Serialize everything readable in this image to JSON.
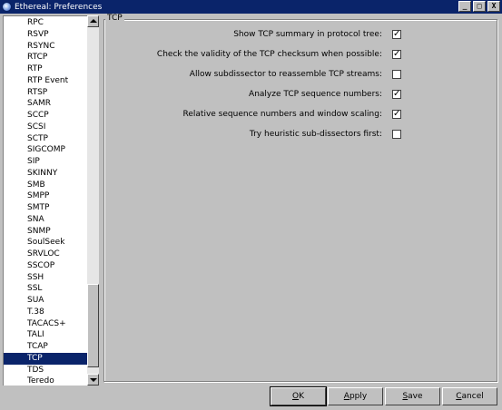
{
  "window": {
    "title": "Ethereal: Preferences",
    "minimize_glyph": "_",
    "maximize_glyph": "□",
    "close_glyph": "X"
  },
  "protocol_list": {
    "items": [
      "RPC",
      "RSVP",
      "RSYNC",
      "RTCP",
      "RTP",
      "RTP Event",
      "RTSP",
      "SAMR",
      "SCCP",
      "SCSI",
      "SCTP",
      "SIGCOMP",
      "SIP",
      "SKINNY",
      "SMB",
      "SMPP",
      "SMTP",
      "SNA",
      "SNMP",
      "SoulSeek",
      "SRVLOC",
      "SSCOP",
      "SSH",
      "SSL",
      "SUA",
      "T.38",
      "TACACS+",
      "TALI",
      "TCAP",
      "TCP",
      "TDS",
      "Teredo"
    ],
    "selected": "TCP"
  },
  "tcp_group": {
    "title": "TCP",
    "options": [
      {
        "label": "Show TCP summary in protocol tree:",
        "checked": true
      },
      {
        "label": "Check the validity of the TCP checksum when possible:",
        "checked": true
      },
      {
        "label": "Allow subdissector to reassemble TCP streams:",
        "checked": false
      },
      {
        "label": "Analyze TCP sequence numbers:",
        "checked": true
      },
      {
        "label": "Relative sequence numbers and window scaling:",
        "checked": true
      },
      {
        "label": "Try heuristic sub-dissectors first:",
        "checked": false
      }
    ]
  },
  "buttons": {
    "ok": {
      "accel": "O",
      "rest": "K"
    },
    "apply": {
      "accel": "A",
      "rest": "pply"
    },
    "save": {
      "accel": "S",
      "rest": "ave"
    },
    "cancel": {
      "accel": "C",
      "rest": "ancel"
    }
  },
  "colors": {
    "titlebar": "#0a246a",
    "selection": "#0a246a",
    "face": "#c0c0c0"
  }
}
